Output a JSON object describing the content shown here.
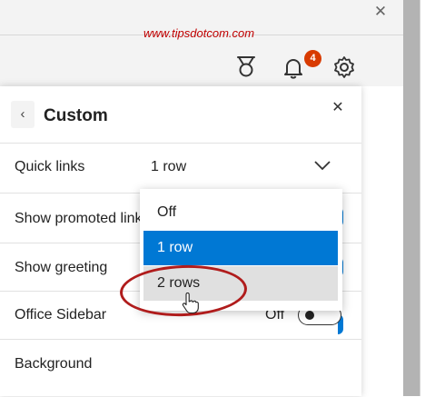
{
  "watermark": "www.tipsdotcom.com",
  "toolbar": {
    "icons": [
      "rewards-icon",
      "bell-icon",
      "gear-icon"
    ],
    "notification_count": "4"
  },
  "panel": {
    "title": "Custom",
    "back_icon": "chevron-left-icon",
    "close_icon": "close-icon"
  },
  "settings": {
    "quick_links": {
      "label": "Quick links",
      "value": "1 row"
    },
    "promoted": {
      "label": "Show promoted links"
    },
    "greeting": {
      "label": "Show greeting"
    },
    "office_sidebar": {
      "label": "Office Sidebar",
      "state": "Off"
    },
    "background": {
      "label": "Background"
    }
  },
  "dropdown": {
    "options": [
      "Off",
      "1 row",
      "2 rows"
    ],
    "selected": "1 row",
    "hovered": "2 rows"
  },
  "colors": {
    "accent": "#0078d4",
    "badge": "#d83b01",
    "annotation": "#b01c1c"
  }
}
